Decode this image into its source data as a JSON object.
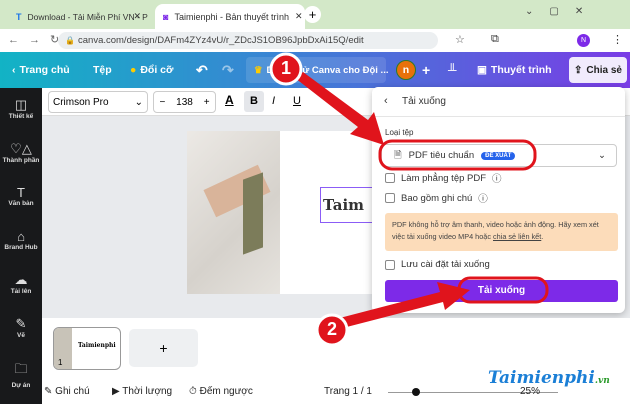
{
  "browser": {
    "tabs": [
      {
        "title": "Download - Tải Miễn Phí VN - P"
      },
      {
        "title": "Taimienphi - Bản thuyết trình"
      }
    ],
    "url": "canva.com/design/DAFm4ZYz4vU/r_ZDcJS1OB96JpbDxAi15Q/edit",
    "profile_initial": "N"
  },
  "toolbar": {
    "home": "Trang chủ",
    "file": "Tệp",
    "resize": "Đổi cỡ",
    "title": "Dùng thử Canva cho Đội ...",
    "avatar": "n",
    "present": "Thuyết trình",
    "share": "Chia sẻ"
  },
  "sidebar": {
    "items": [
      {
        "label": "Thiết kế"
      },
      {
        "label": "Thành phần"
      },
      {
        "label": "Văn bản"
      },
      {
        "label": "Brand Hub"
      },
      {
        "label": "Tải lên"
      },
      {
        "label": "Vẽ"
      },
      {
        "label": "Dự án"
      }
    ]
  },
  "editor": {
    "font": "Crimson Pro",
    "size": "138",
    "bold": "B",
    "italic": "I",
    "underline": "U",
    "color_letter": "A",
    "canvas_text": "Taim"
  },
  "panel": {
    "title": "Tải xuống",
    "file_type_label": "Loại tệp",
    "file_type": "PDF tiêu chuẩn",
    "badge": "ĐỀ XUẤT",
    "flatten": "Làm phẳng tệp PDF",
    "include_notes": "Bao gồm ghi chú",
    "notice": "PDF không hỗ trợ âm thanh, video hoặc ảnh động. Hãy xem xét việc tải xuống video MP4 hoặc ",
    "notice_link": "chia sẻ liên kết",
    "notice_end": ".",
    "save_settings": "Lưu cài đặt tải xuống",
    "download": "Tải xuống"
  },
  "thumbs": {
    "page_num": "1",
    "page_text": "Taimienphi",
    "add": "+"
  },
  "bottom": {
    "notes": "Ghi chú",
    "duration": "Thời lượng",
    "timer": "Đếm ngược",
    "page": "Trang 1 / 1",
    "zoom": "25%"
  },
  "annotations": {
    "step1": "1",
    "step2": "2"
  },
  "watermark": {
    "text": "Taimienphi",
    "suffix": ".vn"
  },
  "colors": {
    "accent": "#7d2ae8",
    "annotation": "#e0141c"
  }
}
